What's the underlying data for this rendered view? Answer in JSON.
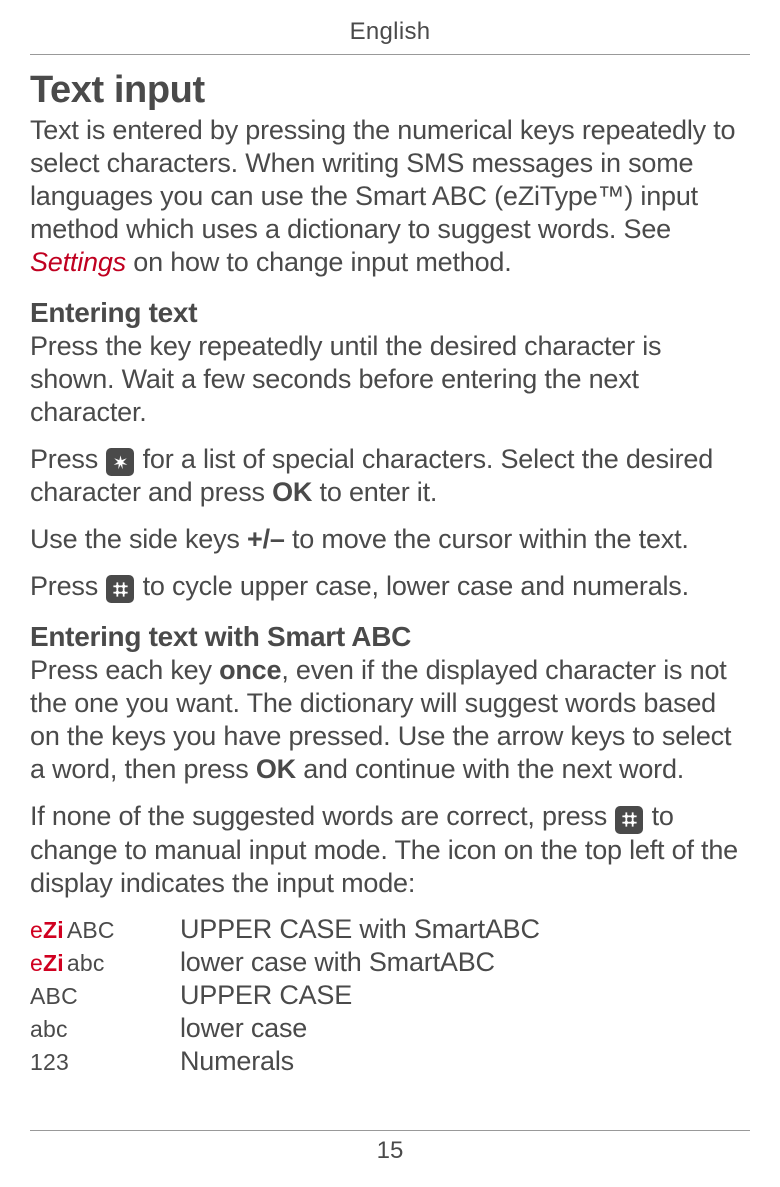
{
  "header": {
    "language": "English"
  },
  "h1": "Text input",
  "intro": {
    "p1_a": "Text is entered by pressing the numerical keys repeatedly to select characters. When writing SMS messages in some languages you can use the Smart ABC (eZiType™) input method which uses a dictionary to suggest words. See ",
    "p1_link": "Settings",
    "p1_b": " on how to change input method."
  },
  "entering_heading": "Entering text",
  "entering_p1": "Press the key repeatedly until the desired character is shown. Wait a few seconds before entering the next character.",
  "entering_p2_a": "Press ",
  "entering_p2_b": " for a list of special characters. Select the desired character and press ",
  "entering_p2_ok": "OK",
  "entering_p2_c": " to enter it.",
  "entering_p3_a": "Use the side keys ",
  "entering_p3_keys": "+/–",
  "entering_p3_b": " to move the cursor within the text.",
  "entering_p4_a": "Press ",
  "entering_p4_b": " to cycle upper case, lower case and numerals.",
  "smart_heading": "Entering text with Smart ABC",
  "smart_p1_a": "Press each key ",
  "smart_p1_once": "once",
  "smart_p1_b": ", even if the displayed character is not the one you want. The dictionary will suggest words based on the keys you have pressed. Use the arrow keys to select a word, then press ",
  "smart_p1_ok": "OK",
  "smart_p1_c": " and continue with the next word.",
  "smart_p2_a": "If none of the suggested words are correct, press ",
  "smart_p2_b": " to change to manual input mode. The icon on the top left of the display indicates the input mode:",
  "modes": [
    {
      "ezi": true,
      "suffix": "ABC",
      "desc": "UPPER CASE with SmartABC"
    },
    {
      "ezi": true,
      "suffix": "abc",
      "desc": "lower case with SmartABC"
    },
    {
      "label": "ABC",
      "desc": "UPPER CASE"
    },
    {
      "label": "abc",
      "desc": "lower case"
    },
    {
      "label": "123",
      "desc": "Numerals"
    }
  ],
  "ezi_parts": {
    "e": "e",
    "Z": "Z",
    "i": "i"
  },
  "page_number": "15"
}
